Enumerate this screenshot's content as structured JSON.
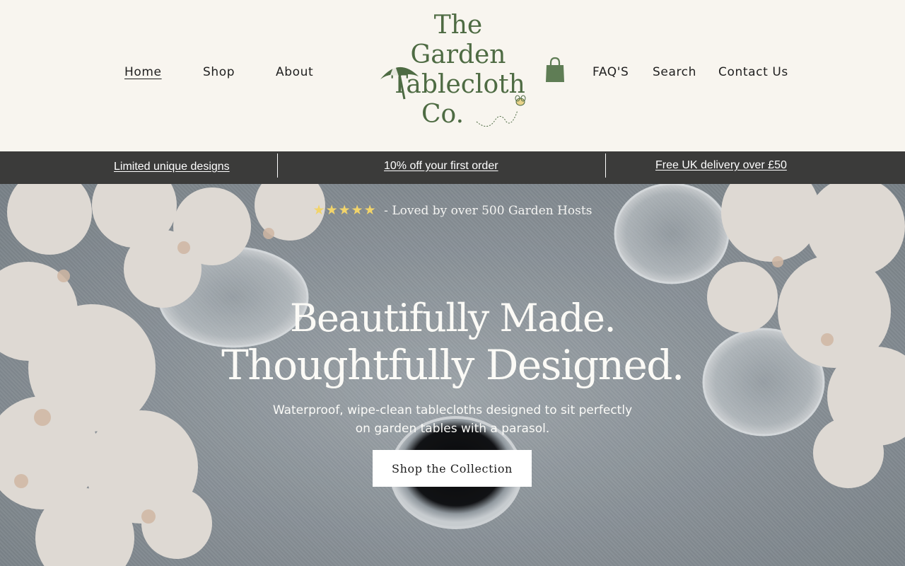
{
  "header": {
    "nav_left": [
      "Home",
      "Shop",
      "About"
    ],
    "nav_right": [
      "FAQ'S",
      "Search",
      "Contact Us"
    ],
    "logo_lines": [
      "The",
      "Garden",
      "Tablecloth",
      "Co."
    ],
    "cart_icon": "shopping-bag-icon"
  },
  "announcement": {
    "items": [
      "Limited unique designs",
      "10% off your first order",
      "Free UK delivery over £50"
    ]
  },
  "hero": {
    "stars": "★★★★★",
    "rating_count": 5,
    "reviews_text": "- Loved by over 500 Garden Hosts",
    "headline_1": "Beautifully Made.",
    "headline_2": "Thoughtfully Designed.",
    "subtext_1": "Waterproof, wipe-clean tablecloths designed to sit perfectly",
    "subtext_2": "on garden tables with a parasol.",
    "cta_label": "Shop the Collection"
  },
  "colors": {
    "brand_green": "#4e6b43",
    "announcement_bg": "#3b3b3a",
    "header_bg": "#f8f5ef",
    "star_color": "#f2d46a"
  }
}
